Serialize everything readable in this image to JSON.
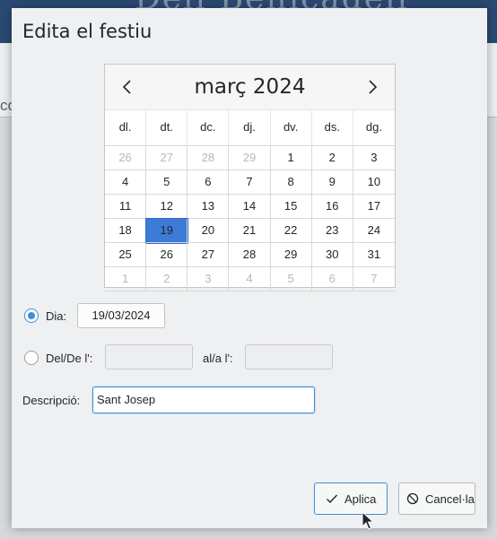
{
  "background": {
    "banner_text": "Dell Benicadell",
    "fragment": "co"
  },
  "dialog": {
    "title": "Edita el festiu",
    "calendar": {
      "month_label": "març 2024",
      "weekdays": [
        "dl.",
        "dt.",
        "dc.",
        "dj.",
        "dv.",
        "ds.",
        "dg."
      ],
      "weeks": [
        [
          "26",
          "27",
          "28",
          "29",
          "1",
          "2",
          "3"
        ],
        [
          "4",
          "5",
          "6",
          "7",
          "8",
          "9",
          "10"
        ],
        [
          "11",
          "12",
          "13",
          "14",
          "15",
          "16",
          "17"
        ],
        [
          "18",
          "19",
          "20",
          "21",
          "22",
          "23",
          "24"
        ],
        [
          "25",
          "26",
          "27",
          "28",
          "29",
          "30",
          "31"
        ],
        [
          "1",
          "2",
          "3",
          "4",
          "5",
          "6",
          "7"
        ]
      ],
      "selected_day": "19",
      "prev_icon": "chevron-left-icon",
      "next_icon": "chevron-right-icon"
    },
    "day_option": {
      "label": "Dia:",
      "value": "19/03/2024",
      "checked": true
    },
    "range_option": {
      "label": "Del/De l':",
      "to_label": "al/a l':",
      "from_value": "",
      "to_value": "",
      "checked": false
    },
    "description": {
      "label": "Descripció:",
      "value": "Sant Josep"
    },
    "buttons": {
      "apply": "Aplica",
      "cancel": "Cancel·la"
    },
    "colors": {
      "accent": "#3d8fd6",
      "selected_day": "#3d7bd6",
      "dialog_bg": "#eff0f1"
    }
  }
}
